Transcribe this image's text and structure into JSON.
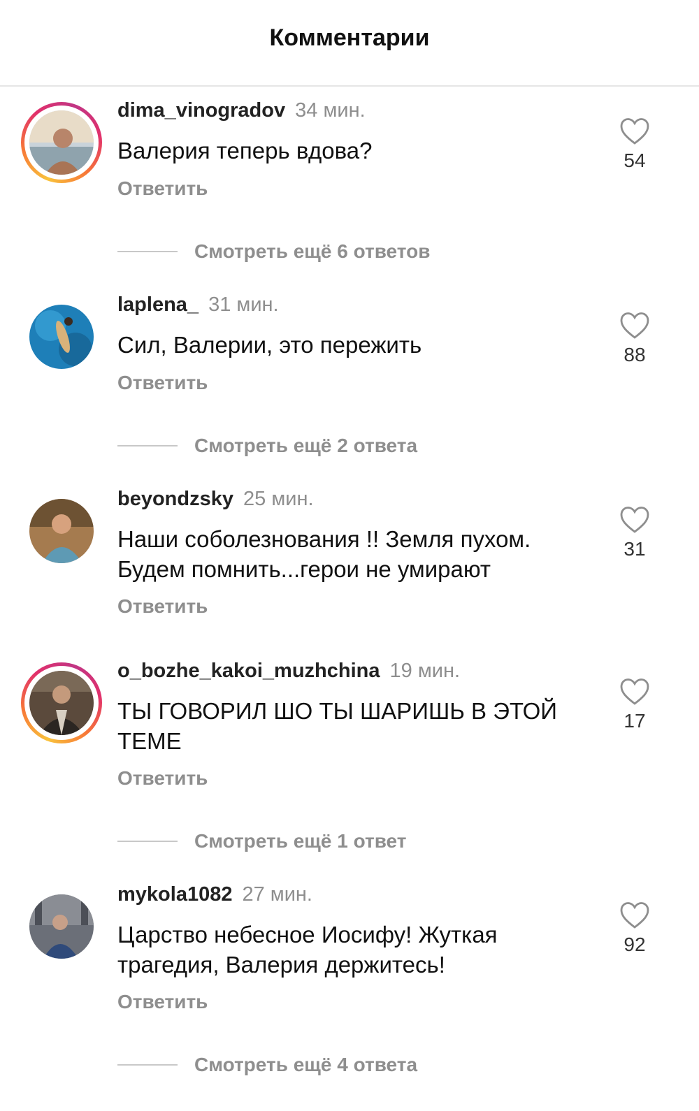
{
  "header": {
    "title": "Комментарии"
  },
  "comments": [
    {
      "username": "dima_vinogradov",
      "time": "34 мин.",
      "text": "Валерия теперь вдова?",
      "reply_label": "Ответить",
      "likes": "54",
      "more_replies": "Смотреть ещё 6 ответов",
      "avatar_icon": "avatar-photo",
      "story_ring": true
    },
    {
      "username": "laplena_",
      "time": "31 мин.",
      "text": "Сил, Валерии, это пережить",
      "reply_label": "Ответить",
      "likes": "88",
      "more_replies": "Смотреть ещё 2 ответа",
      "avatar_icon": "avatar-photo",
      "story_ring": false
    },
    {
      "username": "beyondzsky",
      "time": "25 мин.",
      "text": "Наши соболезнования !! Земля пухом. Будем помнить...герои не умирают",
      "reply_label": "Ответить",
      "likes": "31",
      "more_replies": "",
      "avatar_icon": "avatar-photo",
      "story_ring": false
    },
    {
      "username": "o_bozhe_kakoi_muzhchina",
      "time": "19 мин.",
      "text": "ТЫ ГОВОРИЛ ШО ТЫ ШАРИШЬ В ЭТОЙ ТЕМЕ",
      "reply_label": "Ответить",
      "likes": "17",
      "more_replies": "Смотреть ещё 1 ответ",
      "avatar_icon": "avatar-photo",
      "story_ring": true
    },
    {
      "username": "mykola1082",
      "time": "27 мин.",
      "text": "Царство небесное Иосифу! Жуткая трагедия, Валерия держитесь!",
      "reply_label": "Ответить",
      "likes": "92",
      "more_replies": "Смотреть ещё 4 ответа",
      "avatar_icon": "avatar-photo",
      "story_ring": false
    }
  ],
  "colors": {
    "muted_text": "#8e8e8e",
    "ring_start": "#f9c23c",
    "ring_end": "#c13584"
  },
  "icons": {
    "like": "heart-outline-icon"
  }
}
